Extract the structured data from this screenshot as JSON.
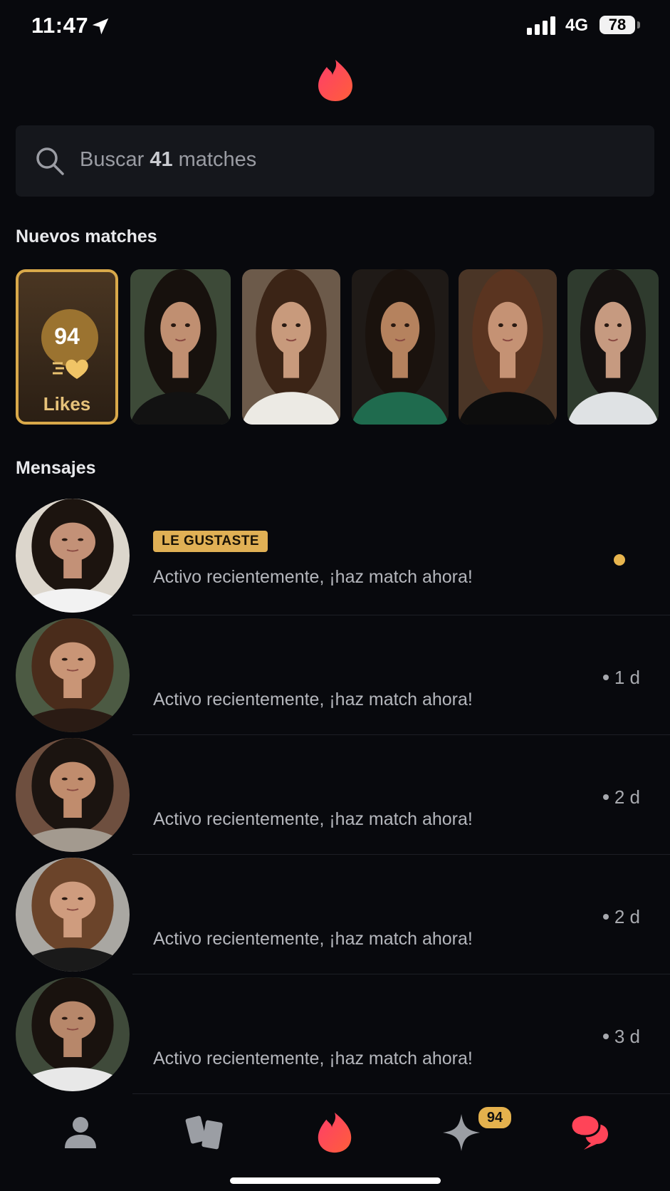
{
  "status_bar": {
    "time": "11:47",
    "network": "4G",
    "battery": "78"
  },
  "search": {
    "prefix": "Buscar ",
    "count": "41",
    "suffix": " matches",
    "icon": "search-icon"
  },
  "new_matches": {
    "title": "Nuevos matches",
    "likes_card": {
      "count": "94",
      "label": "Likes"
    },
    "photos": [
      {
        "bg": "#3d4a38",
        "hair": "#17110d",
        "skin": "#c08f71",
        "top": "#121212"
      },
      {
        "bg": "#6c5a4a",
        "hair": "#3b2416",
        "skin": "#c89a7c",
        "top": "#eceae4"
      },
      {
        "bg": "#1f1a17",
        "hair": "#1a120d",
        "skin": "#b5825e",
        "top": "#1f6b4e"
      },
      {
        "bg": "#4a3526",
        "hair": "#5a3420",
        "skin": "#c59274",
        "top": "#0d0d0d"
      },
      {
        "bg": "#2f3b2e",
        "hair": "#151110",
        "skin": "#c69a80",
        "top": "#dfe2e4"
      }
    ]
  },
  "messages": {
    "title": "Mensajes",
    "rows": [
      {
        "badge": "LE GUSTASTE",
        "text": "Activo recientemente, ¡haz match ahora!",
        "time": "",
        "unread": true,
        "bg": "#dcd6cc",
        "hair": "#1c140f",
        "skin": "#c39177",
        "top": "#f2f2f2"
      },
      {
        "badge": "",
        "text": "Activo recientemente, ¡haz match ahora!",
        "time": "1 d",
        "unread": false,
        "bg": "#4c5a43",
        "hair": "#4a2c1b",
        "skin": "#c99576",
        "top": "#2a1b14"
      },
      {
        "badge": "",
        "text": "Activo recientemente, ¡haz match ahora!",
        "time": "2 d",
        "unread": false,
        "bg": "#6e4f3f",
        "hair": "#1b1410",
        "skin": "#c08c6d",
        "top": "#a39a8f"
      },
      {
        "badge": "",
        "text": "Activo recientemente, ¡haz match ahora!",
        "time": "2 d",
        "unread": false,
        "bg": "#a9a7a2",
        "hair": "#6b442a",
        "skin": "#cf9c7e",
        "top": "#1a1a1a"
      },
      {
        "badge": "",
        "text": "Activo recientemente, ¡haz match ahora!",
        "time": "3 d",
        "unread": false,
        "bg": "#3f4a3a",
        "hair": "#19120e",
        "skin": "#b7876a",
        "top": "#e8e8e8"
      }
    ]
  },
  "tabbar": {
    "tabs": [
      {
        "name": "profile-tab",
        "icon": "person-icon"
      },
      {
        "name": "explore-tab",
        "icon": "cards-icon"
      },
      {
        "name": "home-tab",
        "icon": "flame-icon"
      },
      {
        "name": "likes-tab",
        "icon": "sparkle-icon"
      },
      {
        "name": "chat-tab",
        "icon": "chat-bubbles-icon"
      }
    ],
    "likes_badge": "94"
  },
  "colors": {
    "brand": "#fd4a57",
    "gold": "#e0b055",
    "background": "#08090d"
  }
}
